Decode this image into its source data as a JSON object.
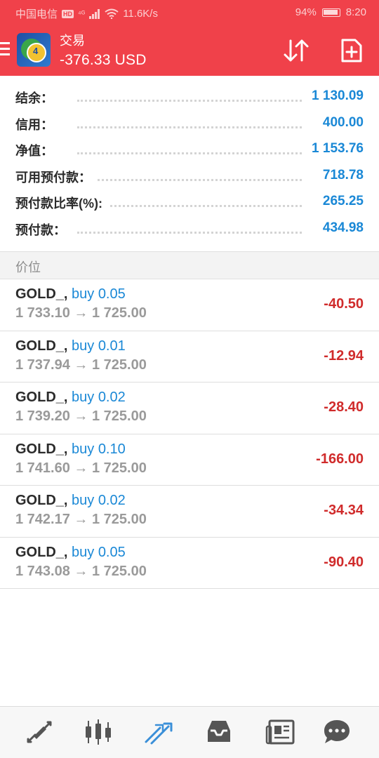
{
  "status_bar": {
    "carrier": "中国电信",
    "hd": "HD",
    "net": "⁴ᴳ",
    "speed": "11.6K/s",
    "battery": "94%",
    "time": "8:20"
  },
  "header": {
    "title": "交易",
    "profit": "-376.33 USD",
    "logo_number": "4"
  },
  "account": [
    {
      "label": "结余：",
      "value": "1 130.09"
    },
    {
      "label": "信用：",
      "value": "400.00"
    },
    {
      "label": "净值：",
      "value": "1 153.76"
    },
    {
      "label": "可用预付款：",
      "value": "718.78"
    },
    {
      "label": "预付款比率(%):",
      "value": "265.25"
    },
    {
      "label": "预付款：",
      "value": "434.98"
    }
  ],
  "section_title": "价位",
  "positions": [
    {
      "symbol": "GOLD_,",
      "side": " buy 0.05",
      "prices": "1 733.10 → 1 725.00",
      "pnl": "-40.50"
    },
    {
      "symbol": "GOLD_,",
      "side": " buy 0.01",
      "prices": "1 737.94 → 1 725.00",
      "pnl": "-12.94"
    },
    {
      "symbol": "GOLD_,",
      "side": " buy 0.02",
      "prices": "1 739.20 → 1 725.00",
      "pnl": "-28.40"
    },
    {
      "symbol": "GOLD_,",
      "side": " buy 0.10",
      "prices": "1 741.60 → 1 725.00",
      "pnl": "-166.00"
    },
    {
      "symbol": "GOLD_,",
      "side": " buy 0.02",
      "prices": "1 742.17 → 1 725.00",
      "pnl": "-34.34"
    },
    {
      "symbol": "GOLD_,",
      "side": " buy 0.05",
      "prices": "1 743.08 → 1 725.00",
      "pnl": "-90.40"
    }
  ],
  "colors": {
    "header_bg": "#f0414a",
    "value_blue": "#1a88d6",
    "loss_red": "#d02b2b",
    "nav_active": "#3a8fd8",
    "nav_icon": "#555555"
  },
  "nav": [
    {
      "icon": "quotes-icon",
      "active": false
    },
    {
      "icon": "chart-icon",
      "active": false
    },
    {
      "icon": "trade-icon",
      "active": true
    },
    {
      "icon": "history-icon",
      "active": false
    },
    {
      "icon": "news-icon",
      "active": false
    },
    {
      "icon": "chat-icon",
      "active": false
    }
  ]
}
